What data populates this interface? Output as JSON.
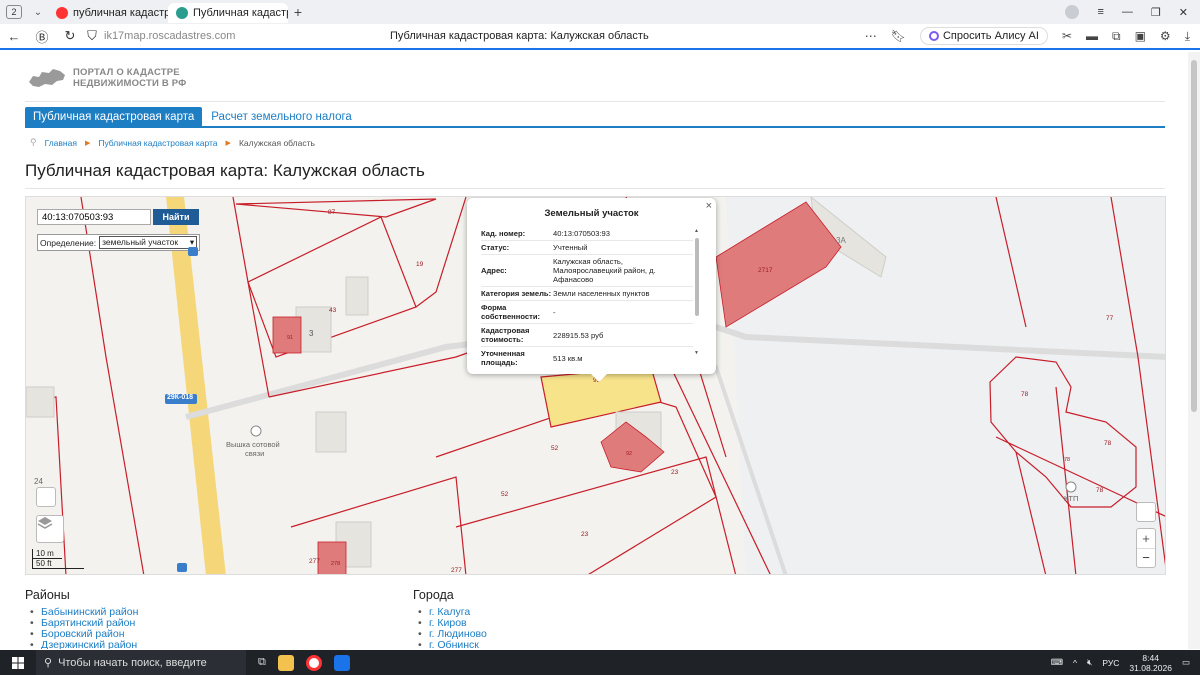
{
  "browser": {
    "tab_count": "2",
    "tabs": [
      {
        "label": "публичная кадастровая к",
        "active": false,
        "favicon_color": "#f33"
      },
      {
        "label": "Публичная кадастровая",
        "active": true,
        "favicon_color": "#2a9d8f"
      }
    ],
    "url": "ik17map.roscadastres.com",
    "page_title": "Публичная кадастровая карта: Калужская область",
    "alice_label": "Спросить Алису AI"
  },
  "site": {
    "logo_line1": "ПОРТАЛ О КАДАСТРЕ",
    "logo_line2": "НЕДВИЖИМОСТИ В РФ",
    "menu": {
      "active": "Публичная кадастровая карта",
      "link": "Расчет земельного налога"
    },
    "breadcrumb": [
      "Главная",
      "Публичная кадастровая карта",
      "Калужская область"
    ],
    "heading": "Публичная кадастровая карта: Калужская область"
  },
  "map": {
    "search_value": "40:13:070503:93",
    "search_button": "Найти",
    "definition_label": "Определение:",
    "definition_value": "земельный участок",
    "scale_m": "10 m",
    "scale_ft": "50 ft",
    "zoom_in": "+",
    "zoom_out": "−",
    "level_label": "24",
    "road_label": "29К-018",
    "poi_label_1": "Вышка сотовой",
    "poi_label_2": "связи",
    "ktp_label": "КТП",
    "labels": [
      "87",
      "19",
      "43",
      "3",
      "91",
      "52",
      "92",
      "23",
      "52",
      "23",
      "277",
      "278",
      "277",
      "93",
      "3А",
      "77",
      "78",
      "78",
      "78",
      "78",
      "2717"
    ],
    "popup": {
      "title": "Земельный участок",
      "rows": [
        {
          "k": "Кад. номер:",
          "v": "40:13:070503:93"
        },
        {
          "k": "Статус:",
          "v": "Учтенный"
        },
        {
          "k": "Адрес:",
          "v": "Калужская область, Малоярославецкий район, д. Афанасово"
        },
        {
          "k": "Категория земель:",
          "v": "Земли населенных пунктов"
        },
        {
          "k": "Форма собственности:",
          "v": "-"
        },
        {
          "k": "Кадастровая стоимость:",
          "v": "228915.53 руб"
        },
        {
          "k": "Уточненная площадь:",
          "v": "513 кв.м"
        }
      ]
    }
  },
  "lists": {
    "districts_title": "Районы",
    "districts": [
      "Бабынинский район",
      "Барятинский район",
      "Боровский район",
      "Дзержинский район"
    ],
    "cities_title": "Города",
    "cities": [
      "г. Калуга",
      "г. Киров",
      "г. Людиново",
      "г. Обнинск"
    ]
  },
  "taskbar": {
    "search_placeholder": "Чтобы начать поиск, введите",
    "lang": "РУС",
    "time": "8:44",
    "date": "31.08.2026"
  },
  "colors": {
    "accent": "#1d7ec4",
    "parcel": "#c81e2a",
    "building": "#e07b7b",
    "selected": "#f7e38a"
  }
}
